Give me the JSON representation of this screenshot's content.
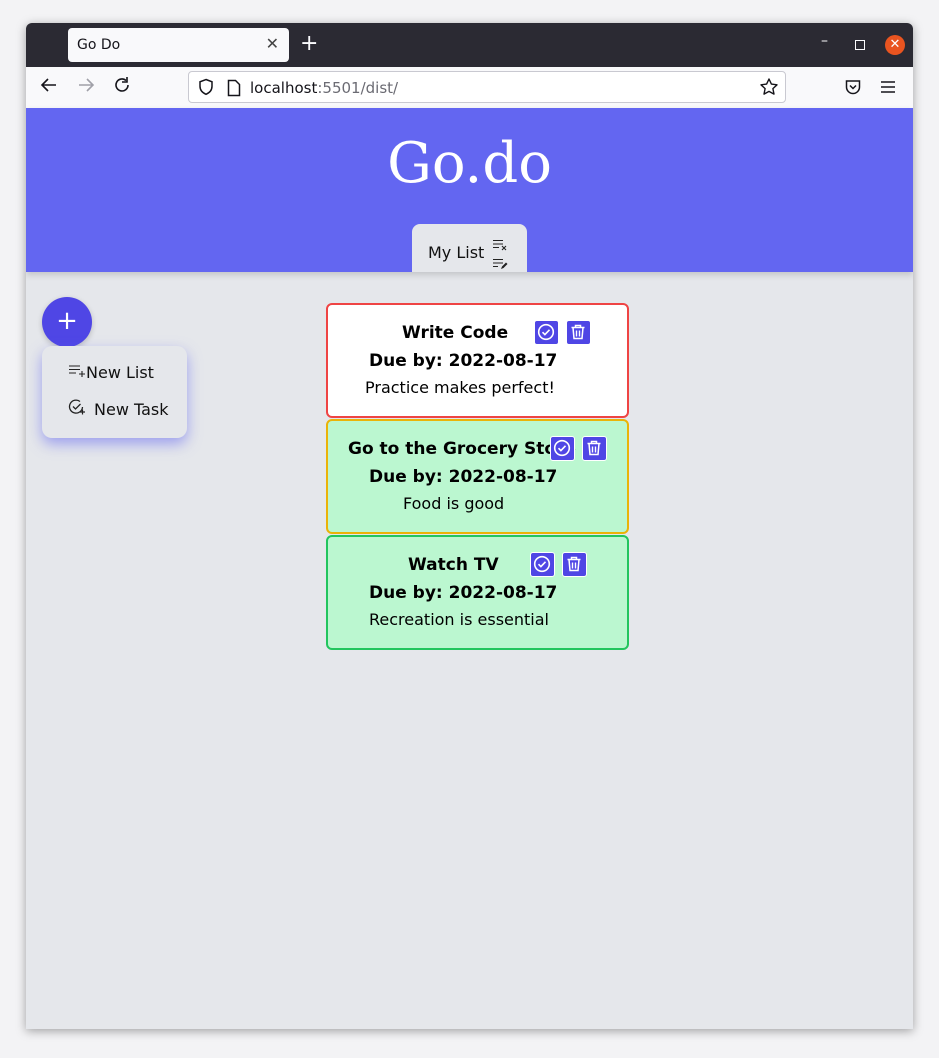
{
  "browser": {
    "tab_title": "Go Do",
    "new_tab_label": "+",
    "url_host": "localhost",
    "url_path": ":5501/dist/"
  },
  "app": {
    "title": "Go.do",
    "active_list": "My List"
  },
  "fab": {
    "label": "+",
    "menu": [
      {
        "label": "New List",
        "icon": "playlist-add-icon"
      },
      {
        "label": "New Task",
        "icon": "check-circle-add-icon"
      }
    ]
  },
  "tasks": [
    {
      "title": "Write Code",
      "due": "Due by: 2022-08-17",
      "description": "Practice makes perfect!",
      "border": "#ef4444",
      "background": "#ffffff"
    },
    {
      "title": "Go to the Grocery Store",
      "due": "Due by: 2022-08-17",
      "description": "Food is good",
      "border": "#eab308",
      "background": "#bbf7d0"
    },
    {
      "title": "Watch TV",
      "due": "Due by: 2022-08-17",
      "description": "Recreation is essential",
      "border": "#22c55e",
      "background": "#bbf7d0"
    }
  ],
  "colors": {
    "header": "#6366f1",
    "accent": "#4f46e5",
    "page_bg": "#e5e7eb"
  }
}
